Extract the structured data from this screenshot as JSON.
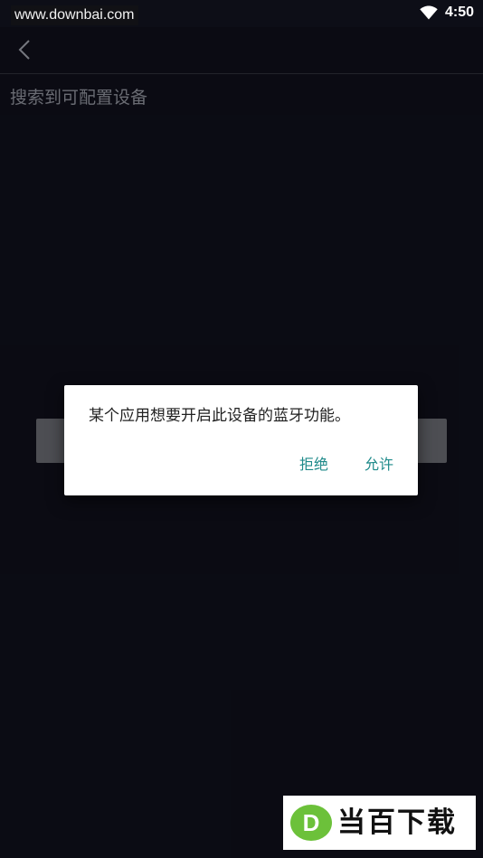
{
  "status_bar": {
    "watermark": "www.downbai.com",
    "time": "4:50",
    "wifi_icon": "wifi-icon"
  },
  "app_bar": {
    "back_icon": "chevron-left-icon"
  },
  "content": {
    "section_title": "搜索到可配置设备"
  },
  "dialog": {
    "message": "某个应用想要开启此设备的蓝牙功能。",
    "deny_label": "拒绝",
    "allow_label": "允许"
  },
  "logo": {
    "mark_letter": "D",
    "text": "当百下载"
  },
  "colors": {
    "background": "#0d0e17",
    "accent": "#1e8a8a",
    "dialog_bg": "#ffffff",
    "logo_green": "#6cc13a"
  }
}
